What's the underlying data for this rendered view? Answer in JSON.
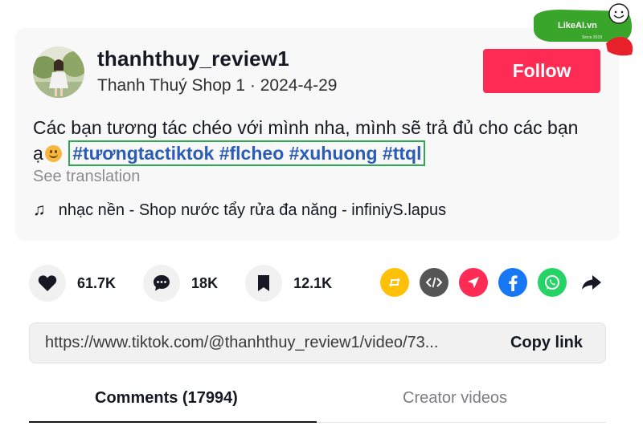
{
  "post": {
    "username": "thanhthuy_review1",
    "subline": "Thanh Thuý Shop 1 · 2024-4-29",
    "follow_label": "Follow",
    "caption_text": "Các bạn tương tác chéo với mình nha, mình sẽ trả đủ cho các bạn ạ",
    "hashtags": [
      "#tươngtactiktok",
      "#flcheo",
      "#xuhuong",
      "#ttql"
    ],
    "see_translation": "See translation",
    "music": "nhạc nền - Shop nước tẩy rửa đa năng - infiniyS.lapus"
  },
  "stats": {
    "likes": "61.7K",
    "comments": "18K",
    "saves": "12.1K"
  },
  "share": {
    "icons": [
      "repost-icon",
      "embed-icon",
      "send-icon",
      "facebook-icon",
      "whatsapp-icon",
      "share-arrow-icon"
    ],
    "colors": {
      "repost": "#ffc107",
      "embed": "#555555",
      "send": "#fe2c55",
      "facebook": "#1877f2",
      "whatsapp": "#25d366"
    }
  },
  "link": {
    "url": "https://www.tiktok.com/@thanhthuy_review1/video/73...",
    "copy_label": "Copy link"
  },
  "tabs": {
    "comments": "Comments (17994)",
    "creator_videos": "Creator videos"
  },
  "watermark": {
    "brand": "LikeAI.vn",
    "tagline": "Since 2019"
  },
  "colors": {
    "follow": "#fe2c55",
    "hashtag": "#2b5db8",
    "highlight_box": "#2eaa55",
    "watermark_green": "#3aa52b"
  }
}
